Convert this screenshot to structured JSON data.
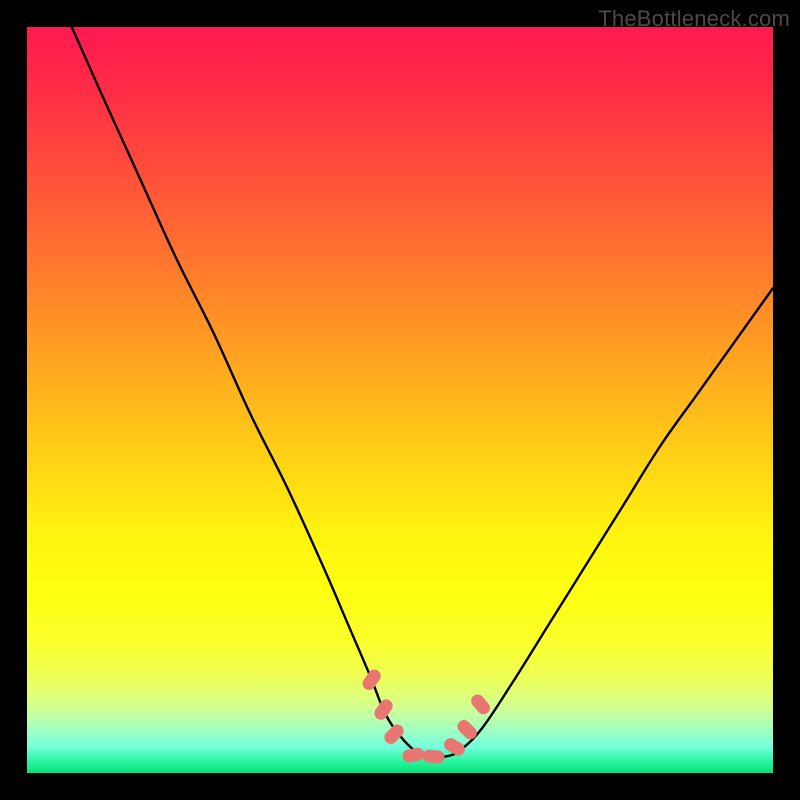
{
  "watermark": "TheBottleneck.com",
  "chart_data": {
    "type": "line",
    "title": "",
    "xlabel": "",
    "ylabel": "",
    "xlim": [
      0,
      100
    ],
    "ylim": [
      0,
      100
    ],
    "series": [
      {
        "name": "curve",
        "x": [
          6,
          10,
          15,
          20,
          25,
          30,
          35,
          40,
          43,
          46,
          48,
          50,
          52,
          54,
          56,
          58,
          61,
          65,
          70,
          75,
          80,
          85,
          90,
          95,
          100
        ],
        "y": [
          100,
          91,
          80,
          69,
          59,
          48,
          38,
          27,
          20,
          13,
          8,
          5,
          3,
          2.2,
          2.2,
          3,
          6,
          12,
          20,
          28,
          36,
          44,
          51,
          58,
          65
        ]
      }
    ],
    "markers": {
      "name": "highlight-points",
      "x": [
        46.2,
        47.8,
        49.2,
        51.8,
        54.5,
        57.3,
        59.0,
        60.8
      ],
      "y": [
        12.5,
        8.5,
        5.2,
        2.4,
        2.2,
        3.5,
        5.8,
        9.2
      ]
    }
  }
}
